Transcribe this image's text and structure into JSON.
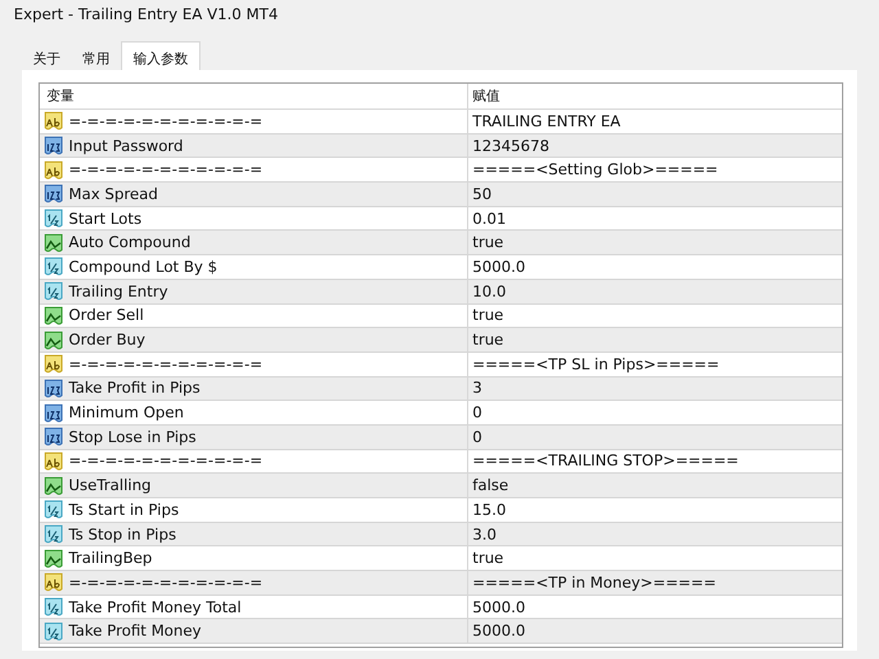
{
  "window": {
    "title": "Expert - Trailing Entry EA V1.0 MT4"
  },
  "tabs": [
    {
      "label": "关于",
      "selected": false
    },
    {
      "label": "常用",
      "selected": false
    },
    {
      "label": "输入参数",
      "selected": true
    }
  ],
  "table": {
    "columns": [
      "变量",
      "赋值"
    ],
    "rows": [
      {
        "kind": "string",
        "name": "=-=-=-=-=-=-=-=-=-=-=",
        "value": "TRAILING ENTRY EA"
      },
      {
        "kind": "int",
        "name": "Input Password",
        "value": "12345678"
      },
      {
        "kind": "string",
        "name": "=-=-=-=-=-=-=-=-=-=-=",
        "value": "=====<Setting Glob>====="
      },
      {
        "kind": "int",
        "name": "Max Spread",
        "value": "50"
      },
      {
        "kind": "double",
        "name": "Start Lots",
        "value": "0.01"
      },
      {
        "kind": "bool",
        "name": "Auto Compound",
        "value": "true"
      },
      {
        "kind": "double",
        "name": "Compound Lot By $",
        "value": "5000.0"
      },
      {
        "kind": "double",
        "name": "Trailing Entry",
        "value": "10.0"
      },
      {
        "kind": "bool",
        "name": "Order Sell",
        "value": "true"
      },
      {
        "kind": "bool",
        "name": "Order Buy",
        "value": "true"
      },
      {
        "kind": "string",
        "name": "=-=-=-=-=-=-=-=-=-=-=",
        "value": "=====<TP SL in Pips>====="
      },
      {
        "kind": "int",
        "name": "Take Profit in Pips",
        "value": "3"
      },
      {
        "kind": "int",
        "name": "Minimum Open",
        "value": "0"
      },
      {
        "kind": "int",
        "name": "Stop Lose in Pips",
        "value": "0"
      },
      {
        "kind": "string",
        "name": "=-=-=-=-=-=-=-=-=-=-=",
        "value": "=====<TRAILING STOP>====="
      },
      {
        "kind": "bool",
        "name": "UseTralling",
        "value": "false"
      },
      {
        "kind": "double",
        "name": "Ts Start in Pips",
        "value": "15.0"
      },
      {
        "kind": "double",
        "name": "Ts Stop in Pips",
        "value": "3.0"
      },
      {
        "kind": "bool",
        "name": "TrailingBep",
        "value": "true"
      },
      {
        "kind": "string",
        "name": "=-=-=-=-=-=-=-=-=-=-=",
        "value": "=====<TP in Money>====="
      },
      {
        "kind": "double",
        "name": "Take Profit Money Total",
        "value": "5000.0"
      },
      {
        "kind": "double",
        "name": "Take Profit Money",
        "value": "5000.0"
      }
    ]
  }
}
